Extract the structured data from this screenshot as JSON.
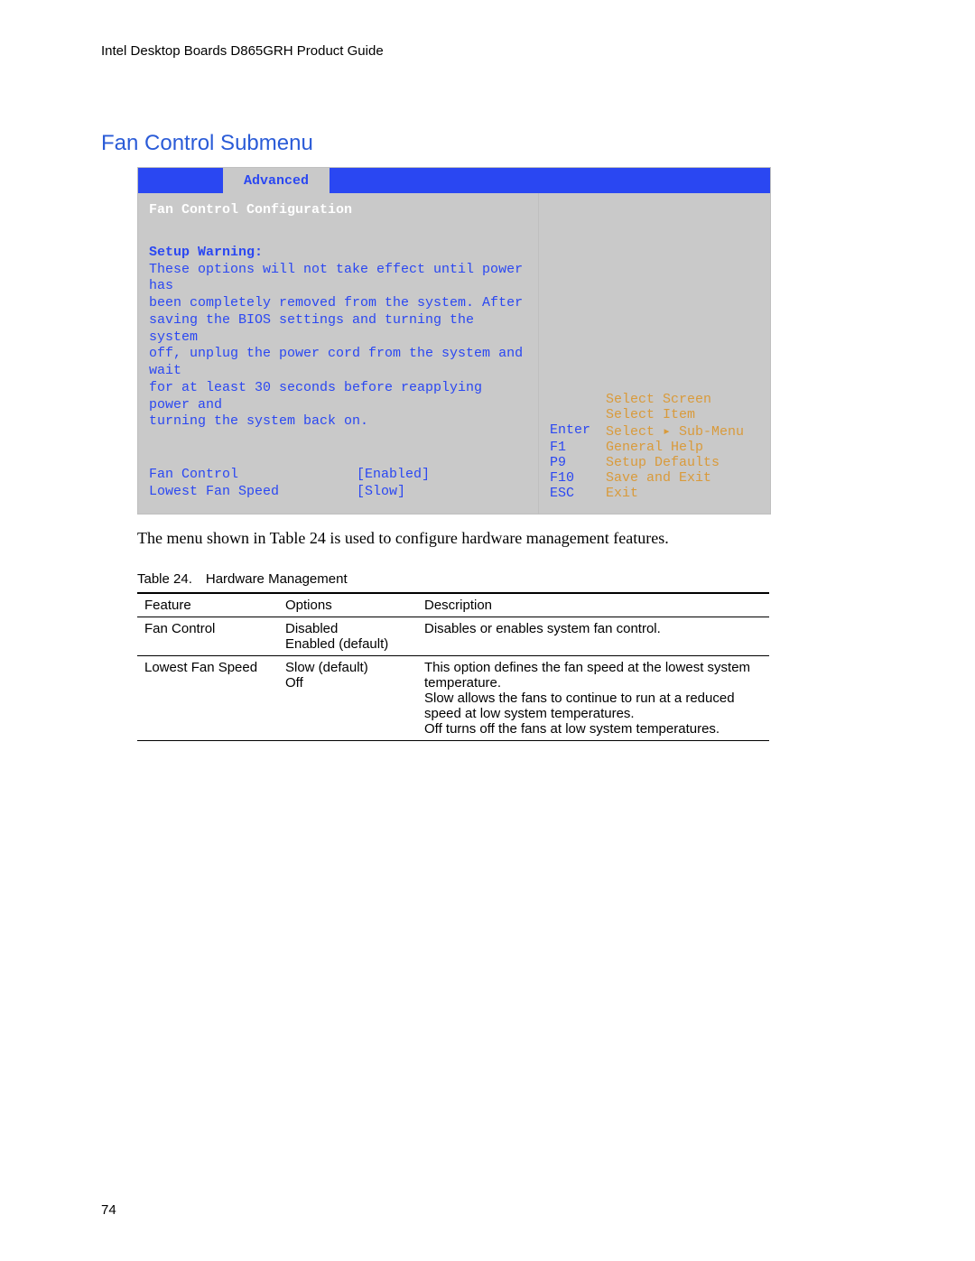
{
  "header": "Intel Desktop Boards D865GRH Product Guide",
  "section_title": "Fan Control Submenu",
  "bios": {
    "tab": "Advanced",
    "subtitle": "Fan Control Configuration",
    "warning_head": "Setup Warning:",
    "warning_body": "These options will not take effect until power has\nbeen completely removed from the system.  After\nsaving the BIOS settings and turning the system\noff, unplug the power cord from the system and wait\nfor at least 30 seconds before reapplying power and\nturning the system back on.",
    "settings": [
      {
        "label": "Fan Control",
        "value": "[Enabled]"
      },
      {
        "label": "Lowest Fan Speed",
        "value": "[Slow]"
      }
    ],
    "help": [
      {
        "key": "",
        "action": "Select Screen"
      },
      {
        "key": "",
        "action": "Select Item"
      },
      {
        "key": "Enter",
        "action": "Select ▸ Sub-Menu"
      },
      {
        "key": "F1",
        "action": "General Help"
      },
      {
        "key": "P9",
        "action": "Setup Defaults"
      },
      {
        "key": "F10",
        "action": "Save and Exit"
      },
      {
        "key": "ESC",
        "action": "Exit"
      }
    ]
  },
  "caption": "The menu shown in Table 24 is used to configure hardware management features.",
  "table_caption": "Table 24. Hardware Management",
  "table": {
    "headers": [
      "Feature",
      "Options",
      "Description"
    ],
    "rows": [
      {
        "feature": "Fan Control",
        "options": "Disabled\nEnabled (default)",
        "description": "Disables or enables system fan control."
      },
      {
        "feature": "Lowest Fan Speed",
        "options": "Slow (default)\nOff",
        "description": "This option defines the fan speed at the lowest system temperature.\nSlow allows the fans to continue to run at a reduced speed at low system temperatures.\nOff turns off the fans at low system temperatures."
      }
    ]
  },
  "page_number": "74"
}
